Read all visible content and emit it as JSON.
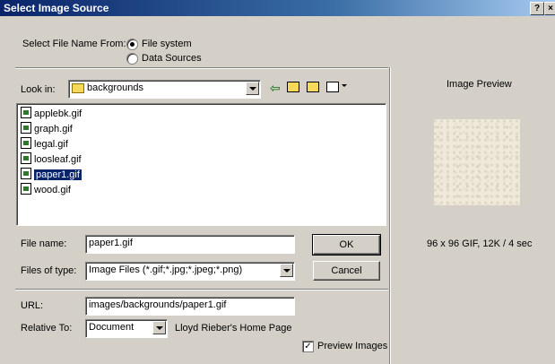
{
  "window": {
    "title": "Select Image Source",
    "help_btn": "?",
    "close_btn": "×"
  },
  "source": {
    "label": "Select File Name From:",
    "options": [
      "File system",
      "Data Sources"
    ]
  },
  "lookin": {
    "label": "Look in:",
    "value": "backgrounds"
  },
  "files": [
    "applebk.gif",
    "graph.gif",
    "legal.gif",
    "loosleaf.gif",
    "paper1.gif",
    "wood.gif"
  ],
  "filename": {
    "label": "File name:",
    "value": "paper1.gif"
  },
  "filetype": {
    "label": "Files of type:",
    "value": "Image Files (*.gif;*.jpg;*.jpeg;*.png)"
  },
  "buttons": {
    "ok": "OK",
    "cancel": "Cancel"
  },
  "url": {
    "label": "URL:",
    "value": "images/backgrounds/paper1.gif"
  },
  "relative": {
    "label": "Relative To:",
    "value": "Document",
    "note": "Lloyd Rieber's Home Page"
  },
  "preview": {
    "title": "Image Preview",
    "info": "96 x 96 GIF, 12K / 4 sec",
    "checkbox": "Preview Images"
  },
  "colors": {
    "selection": "#0a246a",
    "face": "#d4d0c8"
  }
}
